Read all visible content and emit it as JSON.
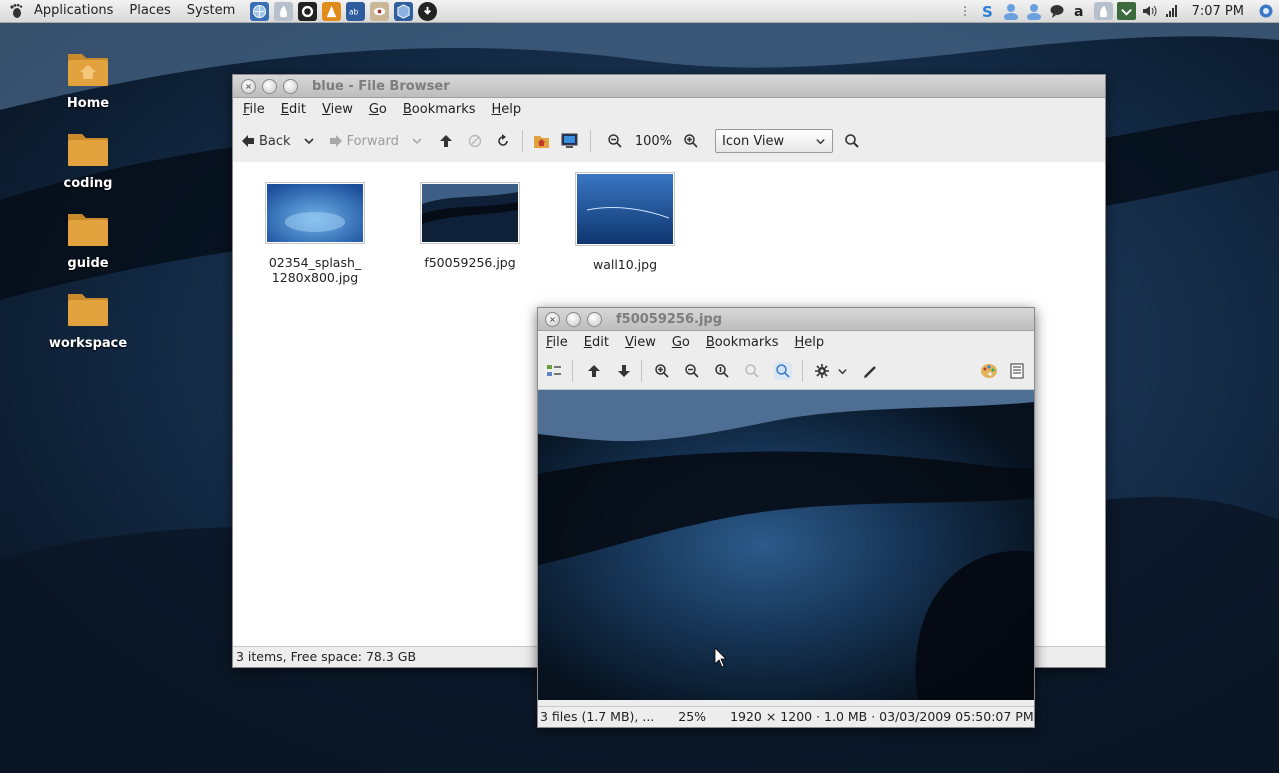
{
  "panel": {
    "menus": [
      "Applications",
      "Places",
      "System"
    ],
    "clock": "7:07 PM"
  },
  "desktop": {
    "icons": [
      {
        "label": "Home"
      },
      {
        "label": "coding"
      },
      {
        "label": "guide"
      },
      {
        "label": "workspace"
      }
    ]
  },
  "file_browser": {
    "title": "blue - File Browser",
    "menu": [
      "File",
      "Edit",
      "View",
      "Go",
      "Bookmarks",
      "Help"
    ],
    "toolbar": {
      "back_label": "Back",
      "forward_label": "Forward",
      "zoom_level": "100%",
      "view_mode": "Icon View"
    },
    "files": [
      {
        "name_line1": "02354_splash_",
        "name_line2": "1280x800.jpg"
      },
      {
        "name_line1": "f50059256.jpg",
        "name_line2": ""
      },
      {
        "name_line1": "wall10.jpg",
        "name_line2": ""
      }
    ],
    "status": "3 items, Free space: 78.3 GB"
  },
  "image_viewer": {
    "title": "f50059256.jpg",
    "menu": [
      "File",
      "Edit",
      "View",
      "Go",
      "Bookmarks",
      "Help"
    ],
    "status": {
      "files": "3 files (1.7 MB), ...",
      "zoom": "25%",
      "info": "1920 × 1200 · 1.0 MB · 03/03/2009 05:50:07 PM"
    }
  },
  "colors": {
    "panel_bg": "#dcdcdc",
    "window_bg": "#ededed",
    "folder_orange": "#e2a33f",
    "wallpaper_dark": "#0d1a2a"
  }
}
